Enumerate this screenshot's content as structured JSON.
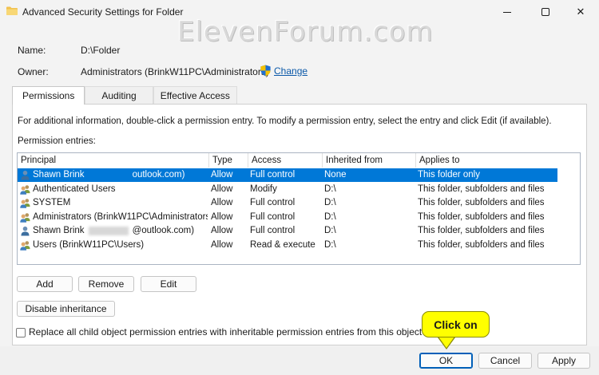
{
  "window": {
    "title": "Advanced Security Settings for Folder",
    "watermark": "ElevenForum.com",
    "close_glyph": "✕"
  },
  "info": {
    "name_label": "Name:",
    "name_value": "D:\\Folder",
    "owner_label": "Owner:",
    "owner_value": "Administrators (BrinkW11PC\\Administrators)",
    "change_label": "Change"
  },
  "tabs": [
    {
      "label": "Permissions",
      "active": true
    },
    {
      "label": "Auditing",
      "active": false
    },
    {
      "label": "Effective Access",
      "active": false
    }
  ],
  "panel": {
    "note": "For additional information, double-click a permission entry. To modify a permission entry, select the entry and click Edit (if available).",
    "entries_label": "Permission entries:"
  },
  "grid": {
    "columns": [
      "Principal",
      "Type",
      "Access",
      "Inherited from",
      "Applies to"
    ],
    "rows": [
      {
        "icon": "user-icon",
        "principal_pre": "Shawn Brink",
        "principal_post": "outlook.com)",
        "type": "Allow",
        "access": "Full control",
        "inherited": "None",
        "applies": "This folder only",
        "selected": true
      },
      {
        "icon": "group-icon",
        "principal_pre": "Authenticated Users",
        "principal_post": "",
        "type": "Allow",
        "access": "Modify",
        "inherited": "D:\\",
        "applies": "This folder, subfolders and files",
        "selected": false
      },
      {
        "icon": "group-icon",
        "principal_pre": "SYSTEM",
        "principal_post": "",
        "type": "Allow",
        "access": "Full control",
        "inherited": "D:\\",
        "applies": "This folder, subfolders and files",
        "selected": false
      },
      {
        "icon": "group-icon",
        "principal_pre": "Administrators (BrinkW11PC\\Administrators)",
        "principal_post": "",
        "type": "Allow",
        "access": "Full control",
        "inherited": "D:\\",
        "applies": "This folder, subfolders and files",
        "selected": false
      },
      {
        "icon": "user-icon",
        "principal_pre": "Shawn Brink",
        "principal_post": "@outlook.com)",
        "type": "Allow",
        "access": "Full control",
        "inherited": "D:\\",
        "applies": "This folder, subfolders and files",
        "selected": false
      },
      {
        "icon": "group-icon",
        "principal_pre": "Users (BrinkW11PC\\Users)",
        "principal_post": "",
        "type": "Allow",
        "access": "Read & execute",
        "inherited": "D:\\",
        "applies": "This folder, subfolders and files",
        "selected": false
      }
    ]
  },
  "buttons": {
    "add": "Add",
    "remove": "Remove",
    "edit": "Edit",
    "disable_inheritance": "Disable inheritance",
    "ok": "OK",
    "cancel": "Cancel",
    "apply": "Apply"
  },
  "replace_checkbox": {
    "label": "Replace all child object permission entries with inheritable permission entries from this object",
    "checked": false
  },
  "callout": {
    "text": "Click on"
  },
  "colors": {
    "selection": "#0078d7",
    "link": "#0a58a8",
    "callout": "#ffff00"
  }
}
